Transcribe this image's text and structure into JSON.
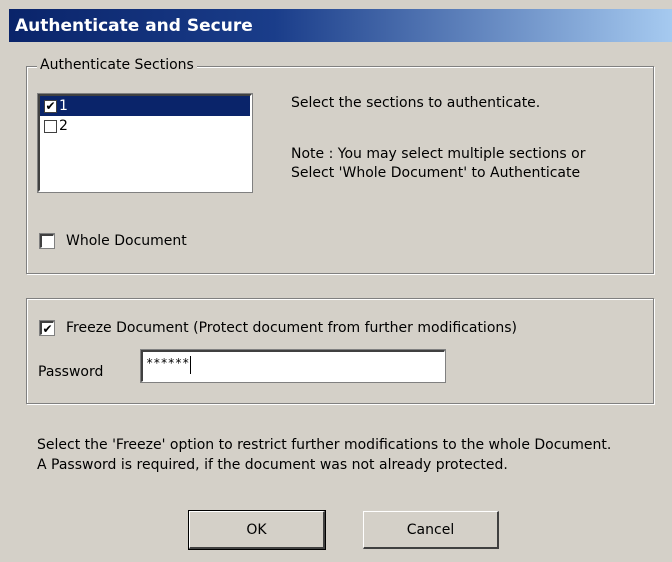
{
  "window": {
    "title": "Authenticate and Secure"
  },
  "sections_group": {
    "legend": "Authenticate Sections",
    "items": [
      {
        "label": "1",
        "checked": "✔",
        "selected": true
      },
      {
        "label": "2",
        "checked": "",
        "selected": false
      }
    ],
    "info_line1": "Select the sections to authenticate.",
    "note_line1": "Note : You may select multiple sections or",
    "note_line2": "Select 'Whole Document' to Authenticate",
    "whole_document_label": "Whole Document",
    "whole_document_checked": ""
  },
  "freeze_group": {
    "freeze_label": "Freeze Document (Protect document from further modifications)",
    "freeze_checked": "✔",
    "password_label": "Password",
    "password_value": "******"
  },
  "help": {
    "line1": "Select the 'Freeze' option to restrict further modifications to the whole Document.",
    "line2": "A Password is required, if the document was not already protected."
  },
  "buttons": {
    "ok": "OK",
    "cancel": "Cancel"
  },
  "colors": {
    "titlebar_start": "#0a246a",
    "titlebar_end": "#a6caf0",
    "dialog_bg": "#d4d0c8",
    "selection_bg": "#0a246a"
  },
  "icons": {
    "check": "check-mark-icon"
  }
}
